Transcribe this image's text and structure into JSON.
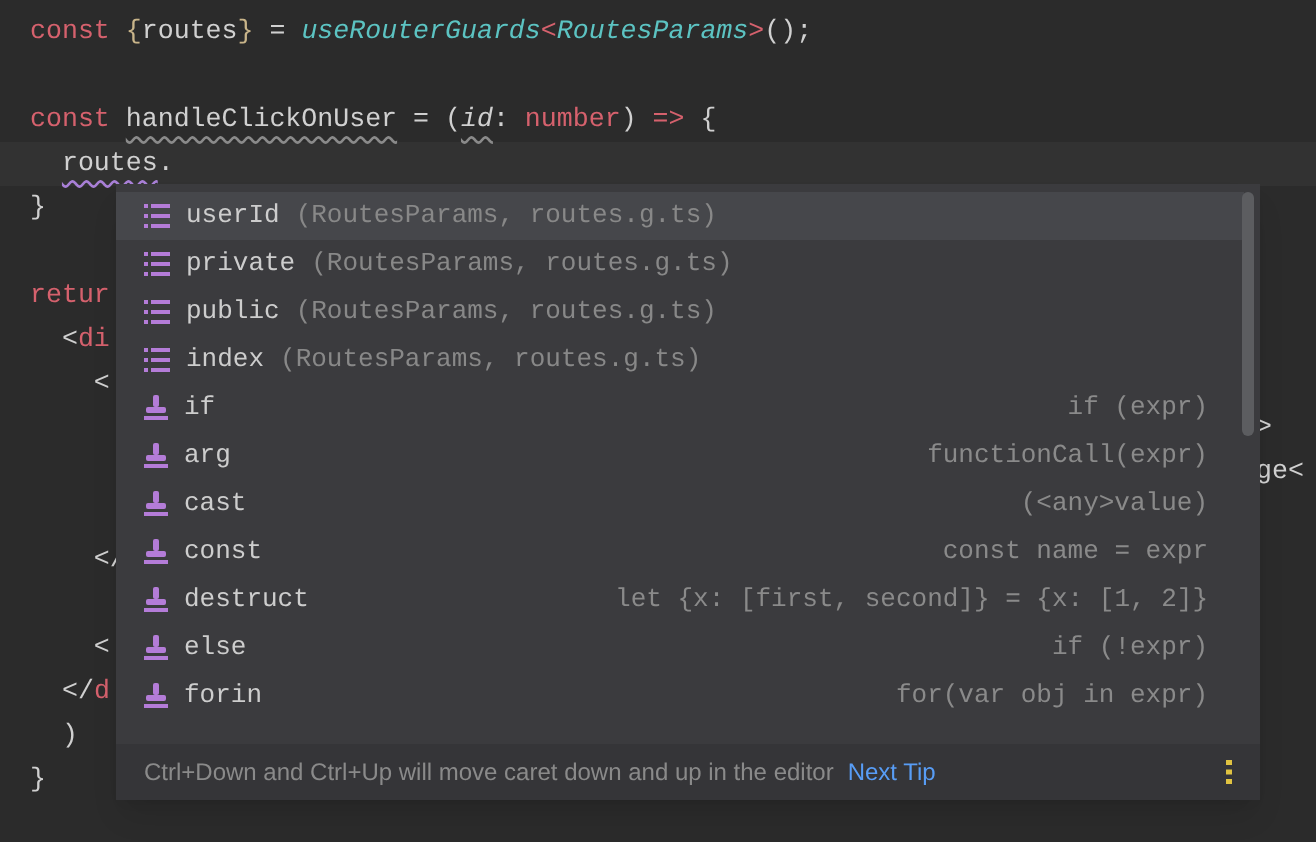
{
  "editor": {
    "blocks": [
      {
        "lines": [
          {
            "tokens": [
              {
                "text": "const ",
                "kind": "keyword"
              },
              {
                "text": "{",
                "kind": "brace"
              },
              {
                "text": "routes",
                "kind": "ident"
              },
              {
                "text": "}",
                "kind": "brace"
              },
              {
                "text": " = ",
                "kind": "ident"
              },
              {
                "text": "useRouterGuards",
                "kind": "call"
              },
              {
                "text": "<",
                "kind": "keyword"
              },
              {
                "text": "RoutesParams",
                "kind": "call"
              },
              {
                "text": ">",
                "kind": "keyword"
              },
              {
                "text": "();",
                "kind": "ident"
              }
            ]
          }
        ]
      },
      {
        "lines": [
          {
            "tokens": [
              {
                "text": "const ",
                "kind": "keyword"
              },
              {
                "text": "handleClickOnUser",
                "kind": "ident",
                "warning": true
              },
              {
                "text": " = (",
                "kind": "ident"
              },
              {
                "text": "id",
                "kind": "param",
                "warning": true
              },
              {
                "text": ": ",
                "kind": "ident"
              },
              {
                "text": "number",
                "kind": "keyword"
              },
              {
                "text": ") ",
                "kind": "ident"
              },
              {
                "text": "=>",
                "kind": "keyword"
              },
              {
                "text": " {",
                "kind": "ident"
              }
            ]
          },
          {
            "current": true,
            "tokens": [
              {
                "text": "  routes",
                "kind": "ident",
                "typo": true
              },
              {
                "text": ".",
                "kind": "ident"
              }
            ]
          },
          {
            "tokens": [
              {
                "text": "}",
                "kind": "ident"
              }
            ]
          }
        ]
      },
      {
        "lines": [
          {
            "tokens": [
              {
                "text": "retur",
                "kind": "keyword"
              }
            ]
          },
          {
            "tokens": [
              {
                "text": "  <",
                "kind": "ident"
              },
              {
                "text": "di",
                "kind": "keyword"
              }
            ]
          },
          {
            "tokens": [
              {
                "text": "    <",
                "kind": "ident"
              }
            ]
          },
          {
            "tail": ">"
          },
          {
            "tail": "ge<"
          }
        ]
      },
      {
        "lines": [
          {
            "tokens": [
              {
                "text": "    </",
                "kind": "ident"
              }
            ]
          }
        ]
      },
      {
        "lines": [
          {
            "tokens": [
              {
                "text": "    <",
                "kind": "ident"
              }
            ]
          },
          {
            "tokens": [
              {
                "text": "  </",
                "kind": "ident"
              },
              {
                "text": "d",
                "kind": "keyword"
              }
            ]
          },
          {
            "tokens": [
              {
                "text": "  )",
                "kind": "ident"
              }
            ]
          },
          {
            "tokens": [
              {
                "text": "}",
                "kind": "ident"
              }
            ]
          }
        ]
      }
    ]
  },
  "completion": {
    "items": [
      {
        "kind": "field",
        "name": "userId",
        "detail": "(RoutesParams, routes.g.ts)",
        "selected": true
      },
      {
        "kind": "field",
        "name": "private",
        "detail": "(RoutesParams, routes.g.ts)",
        "selected": false
      },
      {
        "kind": "field",
        "name": "public",
        "detail": "(RoutesParams, routes.g.ts)",
        "selected": false
      },
      {
        "kind": "field",
        "name": "index",
        "detail": "(RoutesParams, routes.g.ts)",
        "selected": false
      },
      {
        "kind": "template",
        "name": "if",
        "hint": "if (expr)",
        "selected": false
      },
      {
        "kind": "template",
        "name": "arg",
        "hint": "functionCall(expr)",
        "selected": false
      },
      {
        "kind": "template",
        "name": "cast",
        "hint": "(<any>value)",
        "selected": false
      },
      {
        "kind": "template",
        "name": "const",
        "hint": "const name = expr",
        "selected": false
      },
      {
        "kind": "template",
        "name": "destruct",
        "hint": "let {x: [first, second]} = {x: [1, 2]}",
        "selected": false
      },
      {
        "kind": "template",
        "name": "else",
        "hint": "if (!expr)",
        "selected": false
      },
      {
        "kind": "template",
        "name": "forin",
        "hint": "for(var obj in expr)",
        "selected": false
      }
    ],
    "footer": {
      "tip": "Ctrl+Down and Ctrl+Up will move caret down and up in the editor",
      "link": "Next Tip"
    }
  }
}
